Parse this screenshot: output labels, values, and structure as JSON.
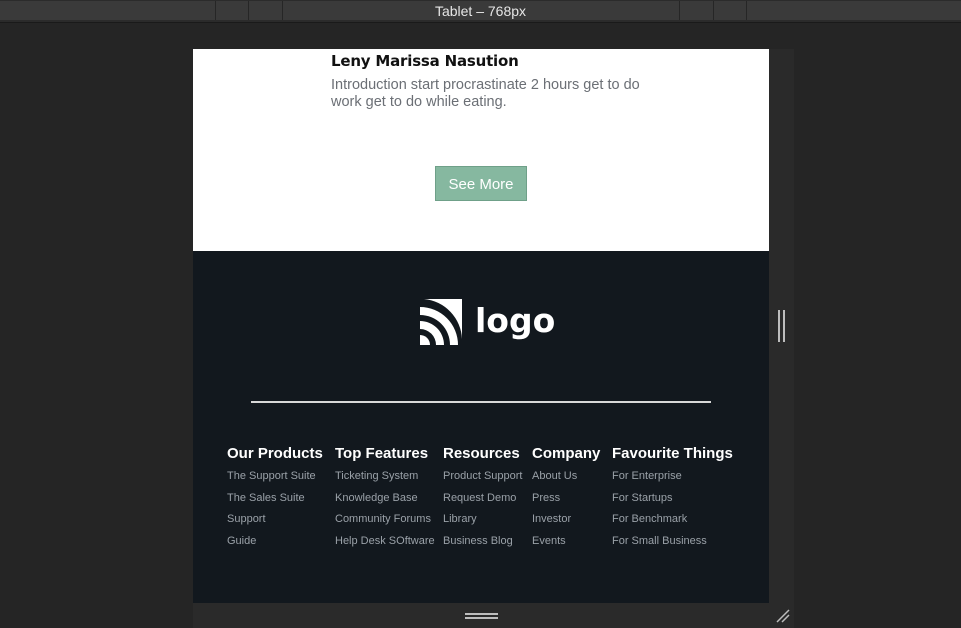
{
  "toolbar": {
    "device_label": "Tablet – 768px"
  },
  "testimonial": {
    "author": "Leny Marissa Nasution",
    "quote": "Introduction start procrastinate 2 hours get to do work get to do while eating.",
    "button_label": "See More",
    "button_color": "#86b8a0"
  },
  "footer": {
    "logo_text": "logo",
    "logo_icon": "logo-arcs-icon",
    "background": "#12181e",
    "columns": [
      {
        "title": "Our Products",
        "links": [
          "The Support Suite",
          "The Sales Suite",
          "Support",
          "Guide"
        ]
      },
      {
        "title": "Top Features",
        "links": [
          "Ticketing System",
          "Knowledge Base",
          "Community Forums",
          "Help Desk SOftware"
        ]
      },
      {
        "title": "Resources",
        "links": [
          "Product Support",
          "Request Demo",
          "Library",
          "Business Blog"
        ]
      },
      {
        "title": "Company",
        "links": [
          "About Us",
          "Press",
          "Investor",
          "Events"
        ]
      },
      {
        "title": "Favourite Things",
        "links": [
          "For Enterprise",
          "For Startups",
          "For Benchmark",
          "For Small Business"
        ]
      }
    ]
  }
}
